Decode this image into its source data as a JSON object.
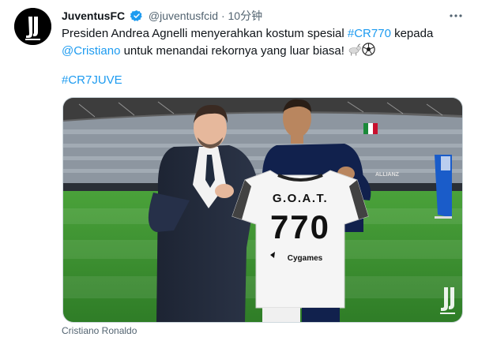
{
  "tweet": {
    "author_name": "JuventusFC",
    "author_handle": "@juventusfcid",
    "separator": "·",
    "time": "10分钟",
    "text_prefix": "Presiden Andrea Agnelli menyerahkan kostum spesial ",
    "hashtag_cr770": "#CR770",
    "text_middle": " kepada",
    "mention": "@Cristiano",
    "text_suffix": " untuk menandai rekornya yang luar biasa! ",
    "emoji_1": "goat-emoji",
    "emoji_2": "soccer-ball-emoji",
    "hashtag_cr7juve": "#CR7JUVE",
    "media_caption": "Cristiano Ronaldo"
  },
  "jersey": {
    "name": "G.O.A.T.",
    "number": "770",
    "sponsor": "Cygames"
  },
  "stadium": {
    "board_text": "ALLIANZ"
  },
  "colors": {
    "link": "#1d9bf0",
    "verified": "#1d9bf0",
    "text": "#0f1419",
    "secondary": "#536471"
  }
}
